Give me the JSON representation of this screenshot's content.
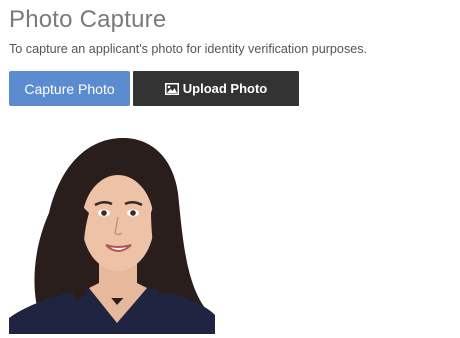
{
  "page": {
    "title": "Photo Capture",
    "description": "To capture an applicant's photo for identity verification purposes."
  },
  "actions": {
    "capture_label": "Capture Photo",
    "upload_label": "Upload Photo"
  },
  "icons": {
    "upload": "image-icon"
  },
  "colors": {
    "capture_button": "#5b8ccf",
    "upload_button": "#333333",
    "title": "#7a7a7a"
  }
}
